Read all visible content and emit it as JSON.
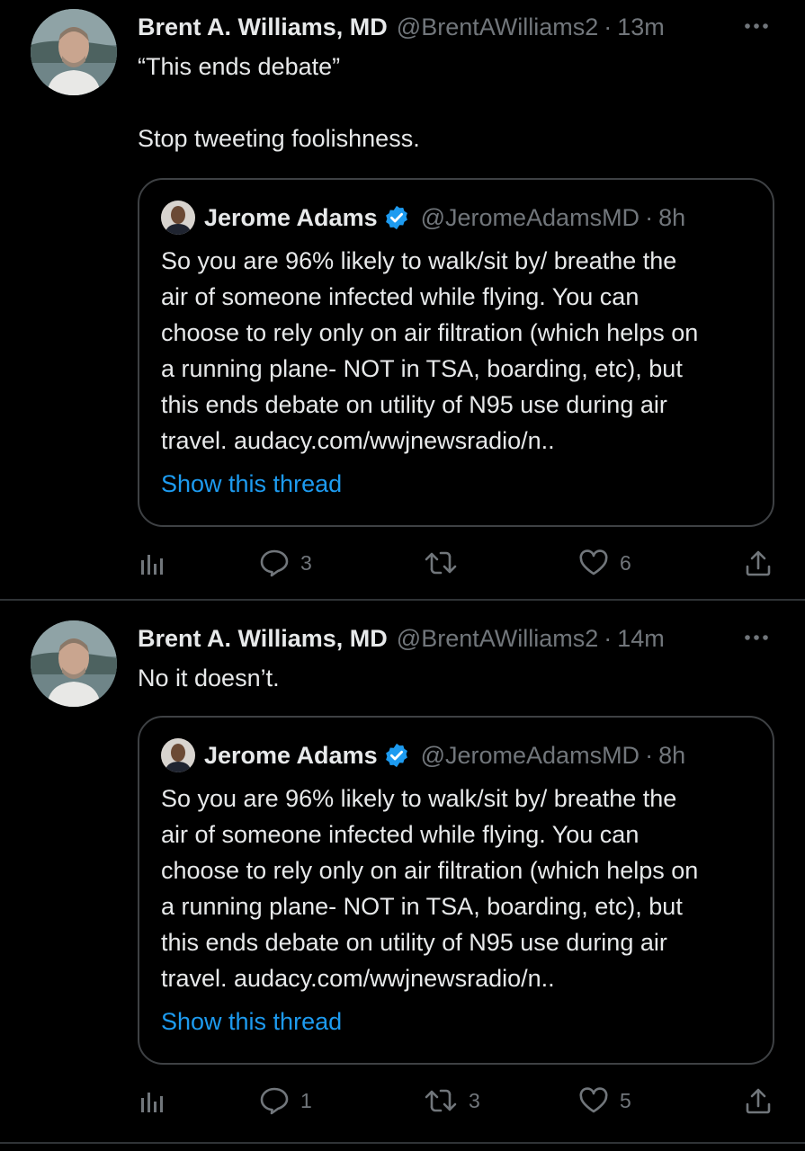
{
  "tweets": [
    {
      "author": {
        "name": "Brent A. Williams, MD",
        "handle": "@BrentAWilliams2",
        "avatar_icon": "profile-photo"
      },
      "time": "13m",
      "body_lines": [
        "“This ends debate”",
        "",
        "Stop tweeting foolishness."
      ],
      "quote": {
        "author": {
          "name": "Jerome Adams",
          "handle": "@JeromeAdamsMD",
          "verified": true,
          "avatar_icon": "profile-photo"
        },
        "time": "8h",
        "lines": [
          "So you are 96% likely to walk/sit by/ breathe the",
          "air of someone infected while flying. You can",
          "choose to rely only on air filtration (which helps on",
          "a running plane- NOT in TSA, boarding, etc), but",
          "this ends debate on utility of N95 use during air",
          "travel. audacy.com/wwjnewsradio/n.."
        ],
        "show_thread": "Show this thread"
      },
      "actions": {
        "analytics": "",
        "replies": "3",
        "retweets": "",
        "likes": "6",
        "share": ""
      }
    },
    {
      "author": {
        "name": "Brent A. Williams, MD",
        "handle": "@BrentAWilliams2",
        "avatar_icon": "profile-photo"
      },
      "time": "14m",
      "body_lines": [
        "No it doesn’t."
      ],
      "quote": {
        "author": {
          "name": "Jerome Adams",
          "handle": "@JeromeAdamsMD",
          "verified": true,
          "avatar_icon": "profile-photo"
        },
        "time": "8h",
        "lines": [
          "So you are 96% likely to walk/sit by/ breathe the",
          "air of someone infected while flying. You can",
          "choose to rely only on air filtration (which helps on",
          "a running plane- NOT in TSA, boarding, etc), but",
          "this ends debate on utility of N95 use during air",
          "travel. audacy.com/wwjnewsradio/n.."
        ],
        "show_thread": "Show this thread"
      },
      "actions": {
        "analytics": "",
        "replies": "1",
        "retweets": "3",
        "likes": "5",
        "share": ""
      }
    }
  ],
  "colors": {
    "background": "#000000",
    "text": "#e7e9ea",
    "secondary": "#71767b",
    "link": "#1d9bf0",
    "verified": "#1d9bf0",
    "divider": "#2f3336"
  }
}
